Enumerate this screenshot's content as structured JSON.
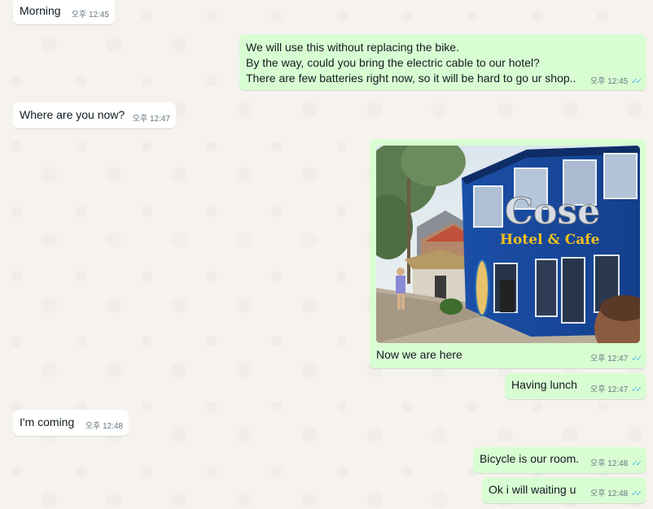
{
  "messages": [
    {
      "id": "m1",
      "dir": "in",
      "lines": [
        "Morning"
      ],
      "period": "오후",
      "time": "12:45"
    },
    {
      "id": "m2",
      "dir": "out",
      "lines": [
        "We will use this without replacing the bike.",
        "By the way, could you bring the electric cable to our hotel?",
        "There are few batteries right now, so it will be hard to go ur shop.."
      ],
      "period": "오후",
      "time": "12:45"
    },
    {
      "id": "m3",
      "dir": "in",
      "lines": [
        "Where are you now?"
      ],
      "period": "오후",
      "time": "12:47"
    },
    {
      "id": "m4",
      "dir": "out",
      "image_sign": {
        "main": "Cose",
        "sub": "Hotel & Cafe"
      },
      "caption": "Now we are here",
      "period": "오후",
      "time": "12:47"
    },
    {
      "id": "m5",
      "dir": "out",
      "lines": [
        "Having lunch"
      ],
      "period": "오후",
      "time": "12:47"
    },
    {
      "id": "m6",
      "dir": "in",
      "lines": [
        "I'm coming"
      ],
      "period": "오후",
      "time": "12:48"
    },
    {
      "id": "m7",
      "dir": "out",
      "lines": [
        "Bicycle is our room."
      ],
      "period": "오후",
      "time": "12:48"
    },
    {
      "id": "m8",
      "dir": "out",
      "lines": [
        "Ok i will waiting u"
      ],
      "period": "오후",
      "time": "12:48"
    }
  ],
  "read_receipt_icon": "double-check-icon",
  "colors": {
    "incoming": "#ffffff",
    "outgoing": "#d9fdd3",
    "read_ticks": "#53bdeb",
    "meta_text": "#667781"
  }
}
